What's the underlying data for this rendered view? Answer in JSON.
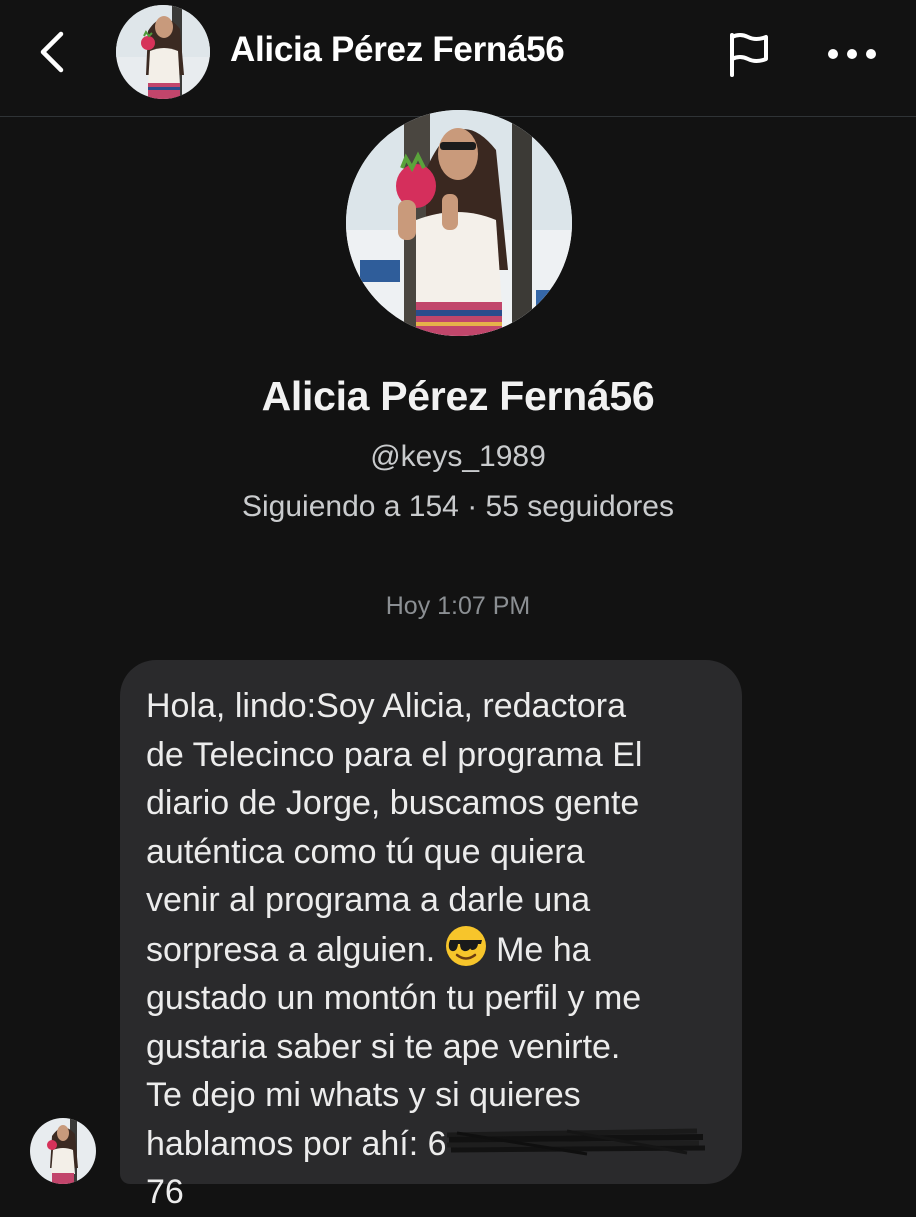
{
  "header": {
    "name": "Alicia Pérez Ferná56",
    "back_icon": "chevron-left-icon",
    "flag_icon": "flag-icon",
    "more_icon": "more-horizontal-icon"
  },
  "profile": {
    "name": "Alicia Pérez Ferná56",
    "handle": "@keys_1989",
    "stats": "Siguiendo a 154 · 55 seguidores"
  },
  "conversation": {
    "timestamp": "Hoy 1:07 PM",
    "message": {
      "text_before_emoji": "Hola, lindo:Soy Alicia, redactora\nde Telecinco para el programa El\ndiario de Jorge, buscamos gente\nauténtica como tú que quiera\nvenir al programa a darle una\nsorpresa a alguien. ",
      "emoji": "smiling-face-with-sunglasses",
      "text_after_emoji": " Me ha\ngustado un montón tu perfil y me\ngustaria saber si te ape venirte.\nTe dejo mi whats y si quieres\nhablamos por ahí: ",
      "redacted_phone_visible": "6",
      "redacted_phone_tail": "76"
    }
  },
  "colors": {
    "background": "#121212",
    "bubble": "#2a2a2c",
    "text_primary": "#ffffff",
    "text_secondary": "#c9cbcd",
    "timestamp": "#8b8f93"
  }
}
